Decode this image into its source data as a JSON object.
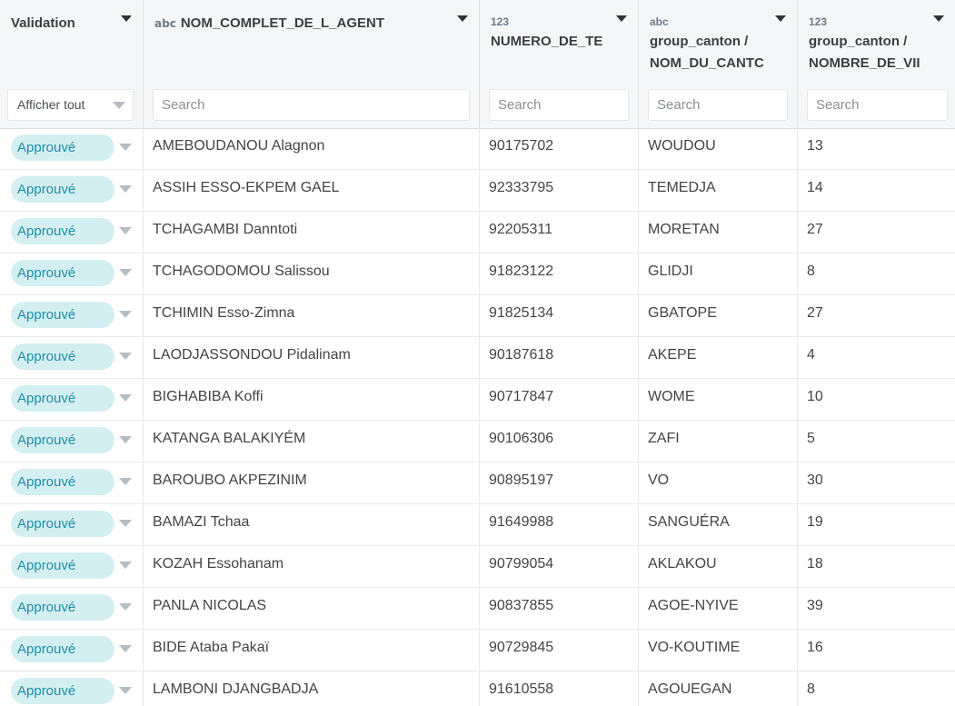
{
  "columns": {
    "validation": {
      "title": "Validation",
      "filter_value": "Afficher tout"
    },
    "agent": {
      "type": "abc",
      "title": "NOM_COMPLET_DE_L_AGENT",
      "placeholder": "Search"
    },
    "phone": {
      "type": "123",
      "title": "NUMERO_DE_TE",
      "placeholder": "Search"
    },
    "canton": {
      "type": "abc",
      "title_line1": "group_canton /",
      "title_line2": "NOM_DU_CANTC",
      "placeholder": "Search"
    },
    "villages": {
      "type": "123",
      "title_line1": "group_canton /",
      "title_line2": "NOMBRE_DE_VII",
      "placeholder": "Search"
    }
  },
  "rows": [
    {
      "status": "Approuvé",
      "name": "AMEBOUDANOU Alagnon",
      "phone": "90175702",
      "canton": "WOUDOU",
      "villages": "13"
    },
    {
      "status": "Approuvé",
      "name": "ASSIH ESSO-EKPEM GAEL",
      "phone": "92333795",
      "canton": "TEMEDJA",
      "villages": "14"
    },
    {
      "status": "Approuvé",
      "name": "TCHAGAMBI Danntoti",
      "phone": "92205311",
      "canton": "MORETAN",
      "villages": "27"
    },
    {
      "status": "Approuvé",
      "name": "TCHAGODOMOU Salissou",
      "phone": "91823122",
      "canton": "GLIDJI",
      "villages": "8"
    },
    {
      "status": "Approuvé",
      "name": "TCHIMIN Esso-Zimna",
      "phone": "91825134",
      "canton": "GBATOPE",
      "villages": "27"
    },
    {
      "status": "Approuvé",
      "name": "LAODJASSONDOU Pidalinam",
      "phone": "90187618",
      "canton": "AKEPE",
      "villages": "4"
    },
    {
      "status": "Approuvé",
      "name": "BIGHABIBA Koffi",
      "phone": "90717847",
      "canton": "WOME",
      "villages": "10"
    },
    {
      "status": "Approuvé",
      "name": "KATANGA BALAKIYÉM",
      "phone": "90106306",
      "canton": "ZAFI",
      "villages": "5"
    },
    {
      "status": "Approuvé",
      "name": "BAROUBO AKPEZINIM",
      "phone": "90895197",
      "canton": "VO",
      "villages": "30"
    },
    {
      "status": "Approuvé",
      "name": "BAMAZI Tchaa",
      "phone": "91649988",
      "canton": "SANGUÉRA",
      "villages": "19"
    },
    {
      "status": "Approuvé",
      "name": "KOZAH Essohanam",
      "phone": "90799054",
      "canton": "AKLAKOU",
      "villages": "18"
    },
    {
      "status": "Approuvé",
      "name": "PANLA NICOLAS",
      "phone": "90837855",
      "canton": "AGOE-NYIVE",
      "villages": "39"
    },
    {
      "status": "Approuvé",
      "name": "BIDE Ataba Pakaï",
      "phone": "90729845",
      "canton": "VO-KOUTIME",
      "villages": "16"
    },
    {
      "status": "Approuvé",
      "name": "LAMBONI DJANGBADJA",
      "phone": "91610558",
      "canton": "AGOUEGAN",
      "villages": "8"
    }
  ]
}
